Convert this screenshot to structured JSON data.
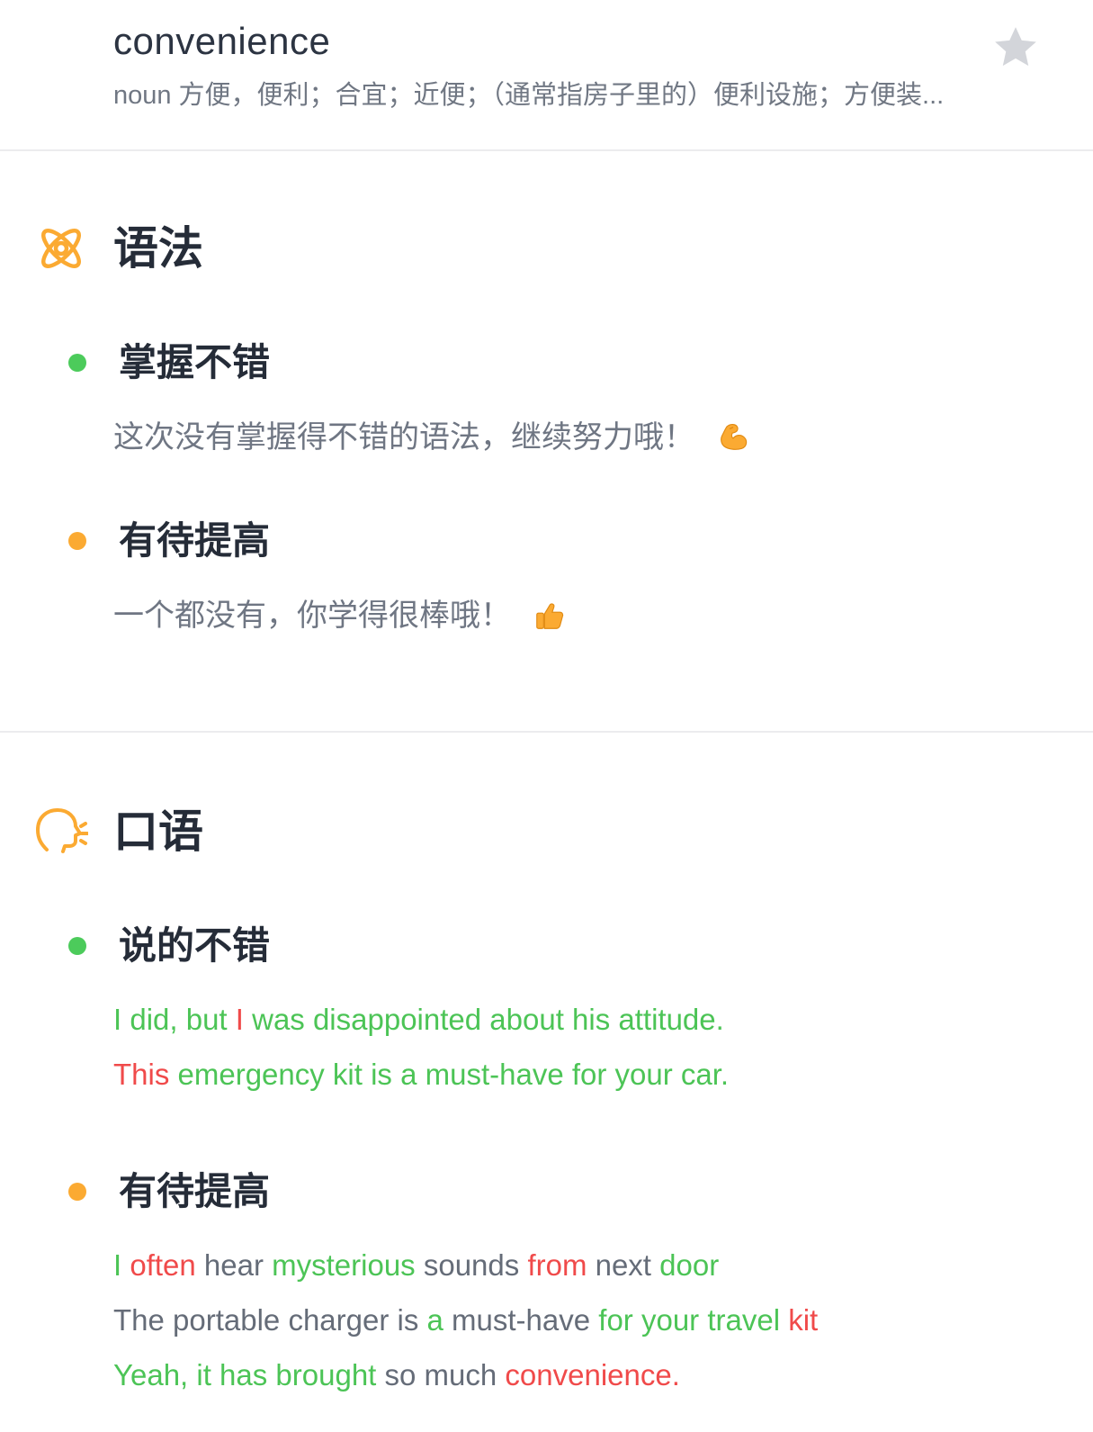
{
  "word": {
    "title": "convenience",
    "pos": "noun",
    "definition": "方便，便利；合宜；近便；（通常指房子里的）便利设施；方便装...",
    "star_icon": "star-icon"
  },
  "grammar": {
    "title": "语法",
    "icon": "grammar-knot-icon",
    "good": {
      "title": "掌握不错",
      "text": "这次没有掌握得不错的语法，继续努力哦！",
      "emoji": "flexed-biceps-emoji"
    },
    "improve": {
      "title": "有待提高",
      "text": "一个都没有，你学得很棒哦！",
      "emoji": "thumbs-up-emoji"
    }
  },
  "speaking": {
    "title": "口语",
    "icon": "speaking-head-icon",
    "good": {
      "title": "说的不错",
      "sentences": [
        [
          {
            "t": "I did, but ",
            "c": "green"
          },
          {
            "t": "I",
            "c": "red"
          },
          {
            "t": " was disappointed about his attitude.",
            "c": "green"
          }
        ],
        [
          {
            "t": "This",
            "c": "red"
          },
          {
            "t": " emergency kit is a must-have for your car.",
            "c": "green"
          }
        ]
      ]
    },
    "improve": {
      "title": "有待提高",
      "sentences": [
        [
          {
            "t": "I ",
            "c": "green"
          },
          {
            "t": "often",
            "c": "red"
          },
          {
            "t": " hear ",
            "c": "gray"
          },
          {
            "t": "mysterious",
            "c": "green"
          },
          {
            "t": " sounds ",
            "c": "gray"
          },
          {
            "t": "from",
            "c": "red"
          },
          {
            "t": " next ",
            "c": "gray"
          },
          {
            "t": "door",
            "c": "green"
          }
        ],
        [
          {
            "t": "The portable charger is ",
            "c": "gray"
          },
          {
            "t": "a",
            "c": "green"
          },
          {
            "t": " must-have ",
            "c": "gray"
          },
          {
            "t": "for your travel ",
            "c": "green"
          },
          {
            "t": "kit",
            "c": "red"
          }
        ],
        [
          {
            "t": "Yeah, it has brought ",
            "c": "green"
          },
          {
            "t": "so",
            "c": "gray"
          },
          {
            "t": " much ",
            "c": "gray"
          },
          {
            "t": "convenience.",
            "c": "red"
          }
        ]
      ]
    }
  },
  "colors": {
    "accent_orange": "#fbaa32",
    "good_green": "#4ccb5b",
    "error_red": "#f04a4a",
    "neutral_gray": "#656c78"
  }
}
